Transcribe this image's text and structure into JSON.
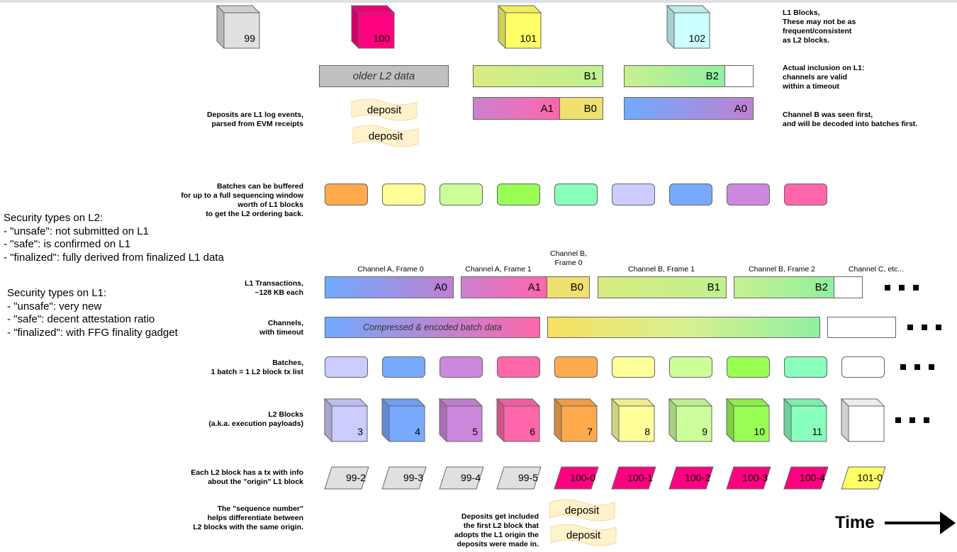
{
  "l1_blocks": [
    {
      "label": "99",
      "color": "#e0e0e0"
    },
    {
      "label": "100",
      "color": "#ff0080"
    },
    {
      "label": "101",
      "color": "#ffff66"
    },
    {
      "label": "102",
      "color": "#ccffff"
    }
  ],
  "l1_inclusion": {
    "older": "older L2 data",
    "b1": "B1",
    "b2": "B2",
    "a1": "A1",
    "b0": "B0",
    "a0": "A0"
  },
  "deposit_label": "deposit",
  "notes": {
    "l1_blocks": "L1 Blocks,\nThese may not be as\nfrequent/consistent\nas L2 blocks.",
    "inclusion": "Actual inclusion on L1:\nchannels are valid\nwithin a timeout",
    "channel_b": "Channel B was seen first,\nand will be decoded into batches first.",
    "deposits": "Deposits are L1 log events,\nparsed from EVM receipts",
    "buffered": "Batches can be buffered\nfor up to a full sequencing window\nworth of L1 blocks\nto get the L2 ordering back.",
    "l1_tx": "L1 Transactions,\n~128 KB each",
    "channels": "Channels,\nwith timeout",
    "batches": "Batches,\n1 batch = 1 L2 block tx list",
    "l2_blocks": "L2 Blocks\n(a.k.a. execution payloads)",
    "origin": "Each L2 block has a tx with info\nabout the \"origin\" L1 block",
    "seqnum": "The \"sequence number\"\nhelps differentiate between\nL2 blocks with the same origin.",
    "deposits_included": "Deposits get included\nthe first L2 block that\nadopts the L1 origin the\ndeposits were made in."
  },
  "security_l2": "Security types on L2:\n- \"unsafe\": not submitted on L1\n- \"safe\": is confirmed on L1\n- \"finalized\": fully derived from finalized L1 data",
  "security_l1": "Security types on L1:\n- \"unsafe\": very new\n- \"safe\": decent attestation ratio\n- \"finalized\": with FFG finality gadget",
  "buffered_batches": [
    "#ffaa4c",
    "#ffff99",
    "#ccff99",
    "#99ff55",
    "#88ffbb",
    "#ccccff",
    "#77aaff",
    "#cc88dd",
    "#ff66aa"
  ],
  "frame_labels": [
    "Channel A, Frame 0",
    "Channel A, Frame 1",
    "Channel B,\nFrame 0",
    "Channel B, Frame 1",
    "Channel B, Frame 2",
    "Channel C, etc..."
  ],
  "l1_tx": [
    "A0",
    "A1",
    "B0",
    "B1",
    "B2"
  ],
  "channel_text": "Compressed & encoded batch data",
  "batches": [
    "#ccccff",
    "#77aaff",
    "#cc88dd",
    "#ff66aa",
    "#ffaa4c",
    "#ffff99",
    "#ccff99",
    "#99ff55",
    "#88ffbb",
    "#ffffff"
  ],
  "l2_blocks": [
    {
      "label": "3",
      "color": "#ccccff"
    },
    {
      "label": "4",
      "color": "#77aaff"
    },
    {
      "label": "5",
      "color": "#cc88dd"
    },
    {
      "label": "6",
      "color": "#ff66aa"
    },
    {
      "label": "7",
      "color": "#ffaa4c"
    },
    {
      "label": "8",
      "color": "#ffff99"
    },
    {
      "label": "9",
      "color": "#ccff99"
    },
    {
      "label": "10",
      "color": "#99ff55"
    },
    {
      "label": "11",
      "color": "#88ffbb"
    },
    {
      "label": "",
      "color": "#ffffff"
    }
  ],
  "origins": [
    {
      "label": "99-2",
      "color": "#e0e0e0"
    },
    {
      "label": "99-3",
      "color": "#e0e0e0"
    },
    {
      "label": "99-4",
      "color": "#e0e0e0"
    },
    {
      "label": "99-5",
      "color": "#e0e0e0"
    },
    {
      "label": "100-0",
      "color": "#ff0080"
    },
    {
      "label": "100-1",
      "color": "#ff0080"
    },
    {
      "label": "100-2",
      "color": "#ff0080"
    },
    {
      "label": "100-3",
      "color": "#ff0080"
    },
    {
      "label": "100-4",
      "color": "#ff0080"
    },
    {
      "label": "101-0",
      "color": "#ffff66"
    }
  ],
  "time_label": "Time"
}
